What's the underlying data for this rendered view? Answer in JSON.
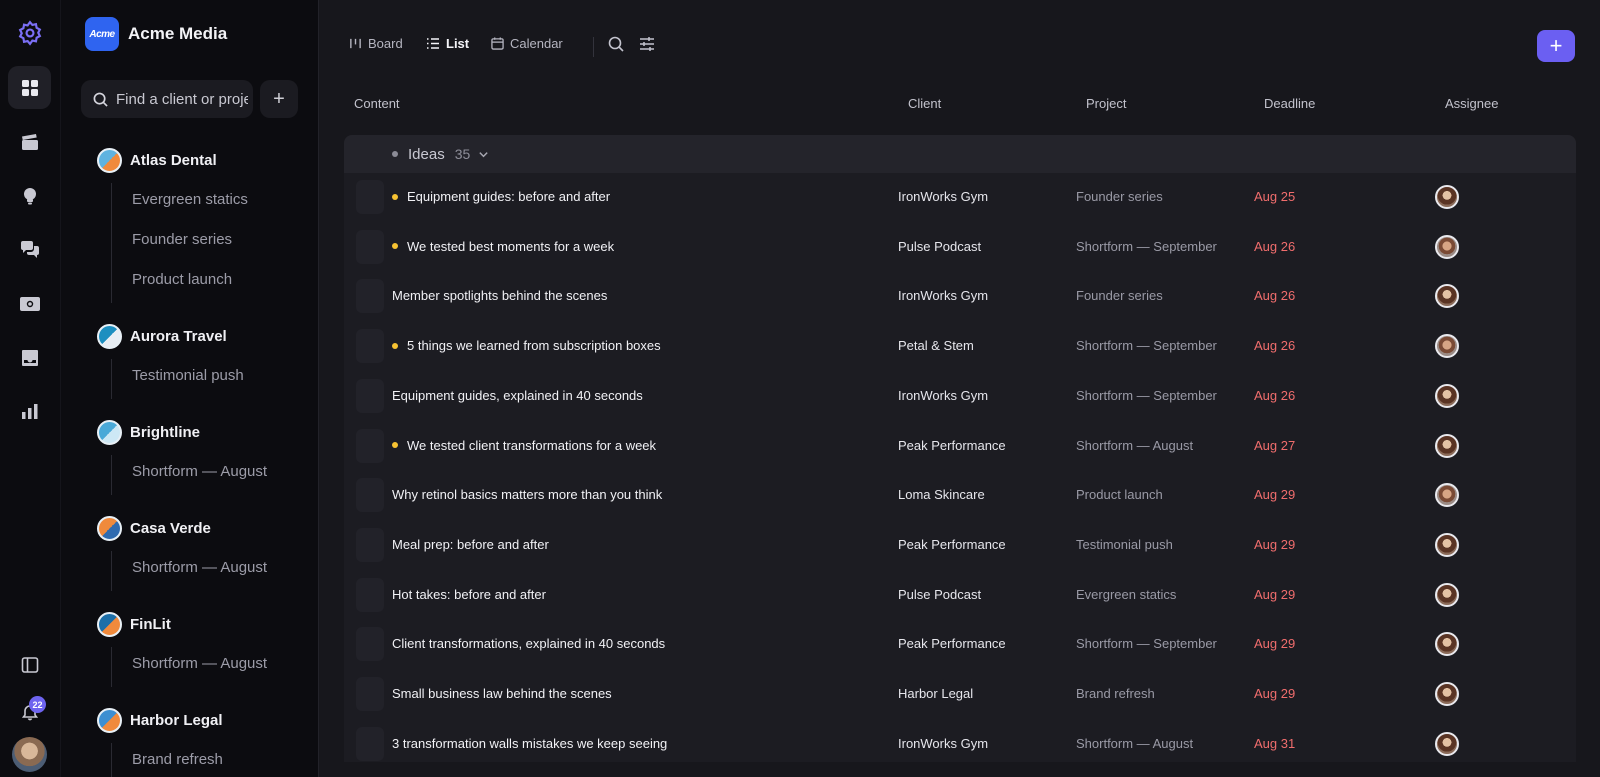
{
  "workspace": {
    "logo_text": "Acme",
    "name": "Acme Media"
  },
  "rail": {
    "items": [
      "settings-logo",
      "dashboard",
      "productions",
      "ideas",
      "chat",
      "money",
      "inbox",
      "analytics"
    ],
    "notification_count": "22"
  },
  "sidebar": {
    "search_placeholder": "Find a client or project",
    "add_label": "+",
    "clients": [
      {
        "name": "Atlas Dental",
        "projects": [
          "Evergreen statics",
          "Founder series",
          "Product launch"
        ],
        "colors": [
          "#5fb3e0",
          "#f08a3c"
        ]
      },
      {
        "name": "Aurora Travel",
        "projects": [
          "Testimonial push"
        ],
        "colors": [
          "#1d8fc0",
          "#e8eef4"
        ]
      },
      {
        "name": "Brightline",
        "projects": [
          "Shortform — August"
        ],
        "colors": [
          "#4aa9d8",
          "#cde8f5"
        ]
      },
      {
        "name": "Casa Verde",
        "projects": [
          "Shortform — August"
        ],
        "colors": [
          "#f08a3c",
          "#2f6bb0"
        ]
      },
      {
        "name": "FinLit",
        "projects": [
          "Shortform — August"
        ],
        "colors": [
          "#1d6fa8",
          "#f08a3c"
        ]
      },
      {
        "name": "Harbor Legal",
        "projects": [
          "Brand refresh"
        ],
        "colors": [
          "#3d8fd1",
          "#f08a3c"
        ]
      }
    ]
  },
  "toolbar": {
    "views": [
      {
        "label": "Board",
        "icon": "board-icon"
      },
      {
        "label": "List",
        "icon": "list-icon",
        "active": true
      },
      {
        "label": "Calendar",
        "icon": "calendar-icon"
      }
    ],
    "add_label": "+"
  },
  "columns": {
    "content": "Content",
    "client": "Client",
    "project": "Project",
    "deadline": "Deadline",
    "assignee": "Assignee"
  },
  "group": {
    "name": "Ideas",
    "count": "35"
  },
  "rows": [
    {
      "title": "Equipment guides: before and after",
      "flag": true,
      "client": "IronWorks Gym",
      "project": "Founder series",
      "deadline": "Aug 25",
      "assignee": "f"
    },
    {
      "title": "We tested best moments for a week",
      "flag": true,
      "client": "Pulse Podcast",
      "project": "Shortform — September",
      "deadline": "Aug 26",
      "assignee": "m"
    },
    {
      "title": "Member spotlights behind the scenes",
      "flag": false,
      "client": "IronWorks Gym",
      "project": "Founder series",
      "deadline": "Aug 26",
      "assignee": "f"
    },
    {
      "title": "5 things we learned from subscription boxes",
      "flag": true,
      "client": "Petal & Stem",
      "project": "Shortform — September",
      "deadline": "Aug 26",
      "assignee": "m"
    },
    {
      "title": "Equipment guides, explained in 40 seconds",
      "flag": false,
      "client": "IronWorks Gym",
      "project": "Shortform — September",
      "deadline": "Aug 26",
      "assignee": "f"
    },
    {
      "title": "We tested client transformations for a week",
      "flag": true,
      "client": "Peak Performance",
      "project": "Shortform — August",
      "deadline": "Aug 27",
      "assignee": "f"
    },
    {
      "title": "Why retinol basics matters more than you think",
      "flag": false,
      "client": "Loma Skincare",
      "project": "Product launch",
      "deadline": "Aug 29",
      "assignee": "m"
    },
    {
      "title": "Meal prep: before and after",
      "flag": false,
      "client": "Peak Performance",
      "project": "Testimonial push",
      "deadline": "Aug 29",
      "assignee": "f"
    },
    {
      "title": "Hot takes: before and after",
      "flag": false,
      "client": "Pulse Podcast",
      "project": "Evergreen statics",
      "deadline": "Aug 29",
      "assignee": "f"
    },
    {
      "title": "Client transformations, explained in 40 seconds",
      "flag": false,
      "client": "Peak Performance",
      "project": "Shortform — September",
      "deadline": "Aug 29",
      "assignee": "f"
    },
    {
      "title": "Small business law behind the scenes",
      "flag": false,
      "client": "Harbor Legal",
      "project": "Brand refresh",
      "deadline": "Aug 29",
      "assignee": "f"
    },
    {
      "title": "3 transformation walls mistakes we keep seeing",
      "flag": false,
      "client": "IronWorks Gym",
      "project": "Shortform — August",
      "deadline": "Aug 31",
      "assignee": "f"
    }
  ]
}
